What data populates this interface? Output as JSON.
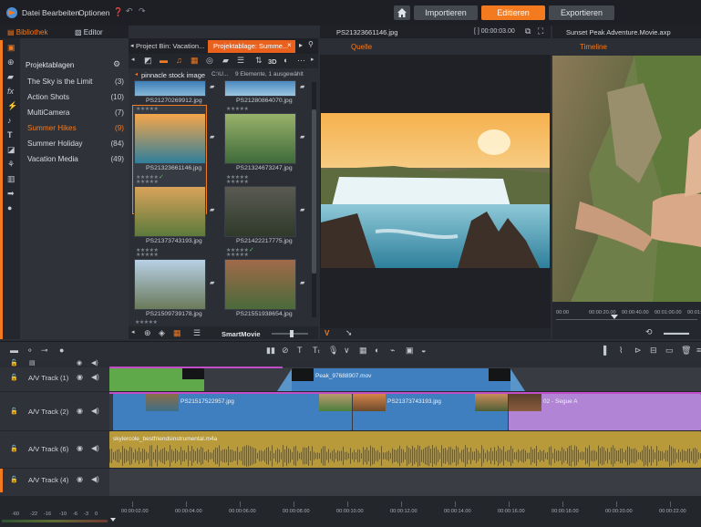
{
  "menu": {
    "datei": "Datei",
    "bearbeiten": "Bearbeiten",
    "optionen": "Optionen"
  },
  "top_tabs": {
    "import": "Importieren",
    "edit": "Editieren",
    "export": "Exportieren"
  },
  "library": {
    "tab_library": "Bibliothek",
    "tab_editor": "Editor",
    "section_title": "Projektablagen",
    "items": [
      {
        "label": "The Sky is the Limit",
        "count": "(3)"
      },
      {
        "label": "Action Shots",
        "count": "(10)"
      },
      {
        "label": "MultiCamera",
        "count": "(7)"
      },
      {
        "label": "Summer Hikes",
        "count": "(9)"
      },
      {
        "label": "Summer Holiday",
        "count": "(84)"
      },
      {
        "label": "Vacation Media",
        "count": "(49)"
      }
    ],
    "active_index": 3
  },
  "browser": {
    "tab1": "Project Bin: Vacation...",
    "tab2": "Projektablage: Summe...",
    "path_label": "pinnacle stock image",
    "path_text": "C:\\U...",
    "status": "9 Elemente, 1 ausgewählt",
    "toggle_3d": "3D",
    "smartmovie": "SmartMovie",
    "files": [
      "PS21270269912.jpg",
      "PS21280864070.jpg",
      "PS21323661146.jpg",
      "PS21324673247.jpg",
      "PS21373743193.jpg",
      "PS21422217775.jpg",
      "PS21509739178.jpg",
      "PS21551938654.jpg"
    ]
  },
  "preview_source": {
    "filename": "PS21323661146.jpg",
    "timecode": "[ ] 00:00:03.00",
    "tab": "Quelle"
  },
  "preview_timeline": {
    "title": "Sunset Peak Adventure.Movie.axp",
    "tab": "Timeline",
    "ruler": [
      "00:00",
      "00:00:20.00",
      "00:00:40.00",
      "00:01:00.00",
      "00:01:"
    ]
  },
  "tracks": [
    {
      "label": "A/V Track (1)"
    },
    {
      "label": "A/V Track (2)"
    },
    {
      "label": "A/V Track (6)"
    },
    {
      "label": "A/V Track (4)"
    }
  ],
  "clips": {
    "t1_clip2": "Peak_97688907.mov",
    "t2_clip1": "PS21517522957.jpg",
    "t2_clip2": "PS21373743193.jpg",
    "t2_clip3": "02 - Segue A",
    "t3_audio": "skylercole_bestfriendsinstrumental.m4a"
  },
  "timeline_ruler": [
    "00:00:02.00",
    "00:00:04.00",
    "00:00:06.00",
    "00:00:08.00",
    "00:00:10.00",
    "00:00:12.00",
    "00:00:14.00",
    "00:00:16.00",
    "00:00:18.00",
    "00:00:20.00",
    "00:00:22.00"
  ],
  "meter_scale": [
    "-60",
    "-22",
    "-16",
    "-10",
    "-6",
    "-3",
    "0"
  ],
  "colors": {
    "accent": "#f47a1f",
    "blue_clip": "#3f7fbf",
    "green_clip": "#5fa94b",
    "purple_clip": "#b184d6",
    "audio_clip": "#b89a3a"
  }
}
